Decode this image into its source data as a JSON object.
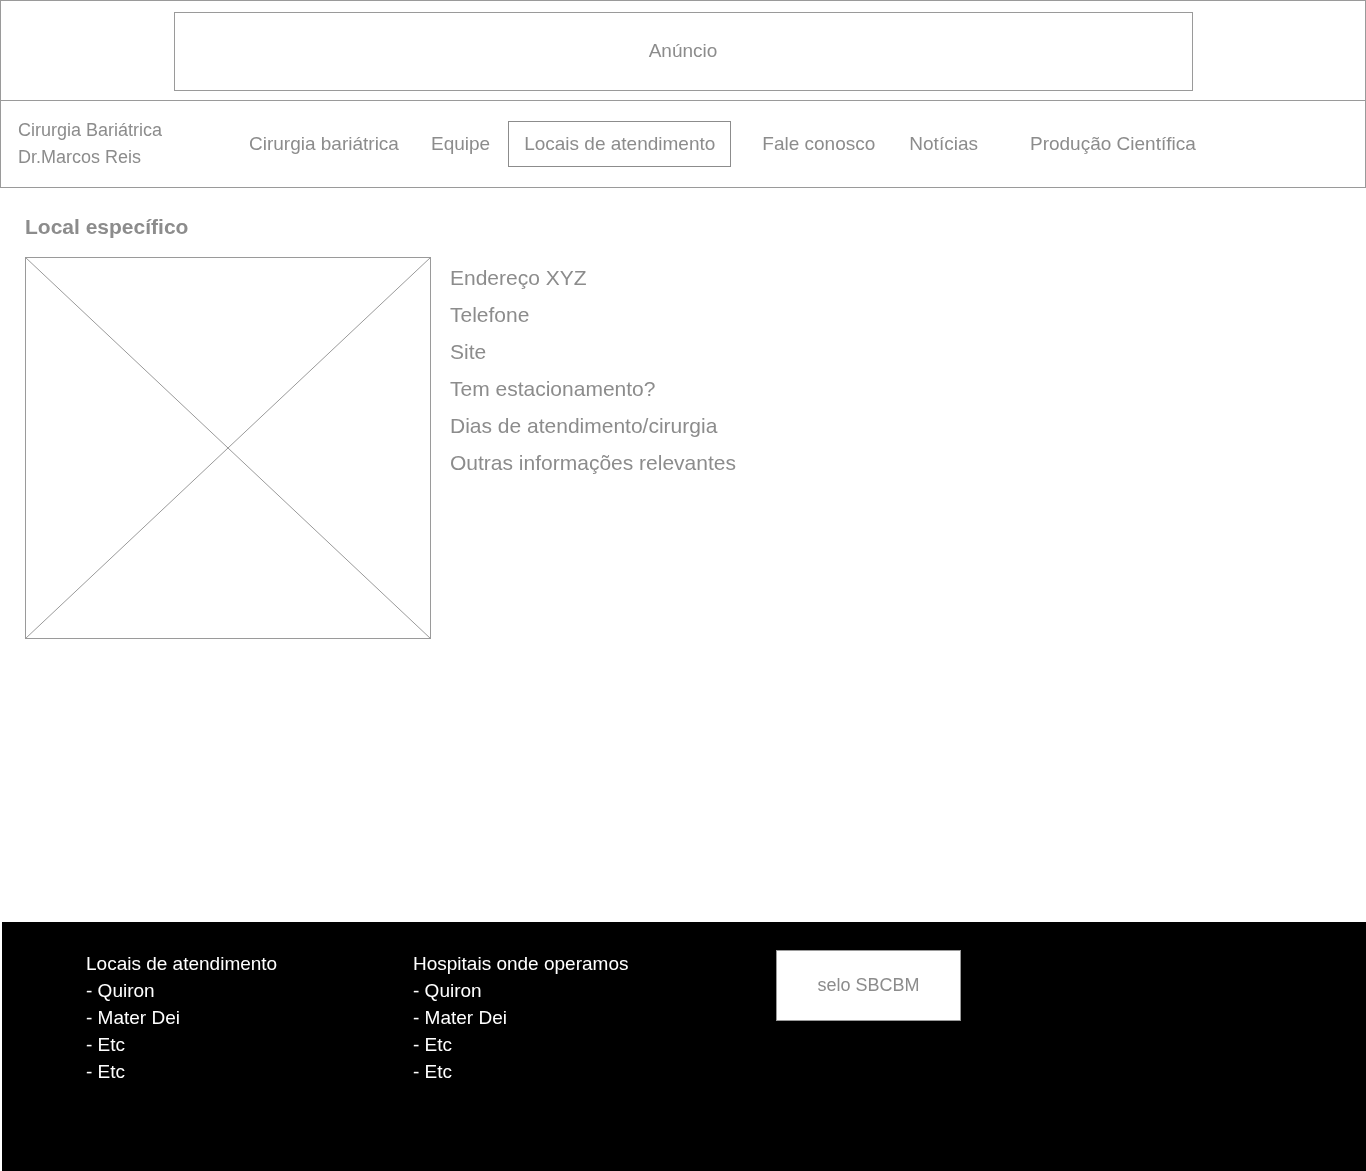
{
  "ad": {
    "label": "Anúncio"
  },
  "header": {
    "brand": [
      "Cirurgia Bariátrica",
      "Dr.Marcos Reis"
    ],
    "nav": [
      {
        "label": "Cirurgia bariátrica",
        "selected": false
      },
      {
        "label": "Equipe",
        "selected": false
      },
      {
        "label": "Locais de atendimento",
        "selected": true
      },
      {
        "label": "Fale conosco",
        "selected": false
      },
      {
        "label": "Notícias",
        "selected": false
      },
      {
        "label": "Produção Científica",
        "selected": false
      }
    ]
  },
  "content": {
    "title": "Local específico",
    "details": [
      "Endereço XYZ",
      "Telefone",
      "Site",
      "Tem estacionamento?",
      "Dias de atendimento/cirurgia",
      "Outras informações relevantes"
    ]
  },
  "footer": {
    "columns": [
      {
        "title": "Locais de atendimento",
        "items": [
          "- Quiron",
          "- Mater Dei",
          "- Etc",
          "- Etc"
        ]
      },
      {
        "title": "Hospitais onde operamos",
        "items": [
          "- Quiron",
          "- Mater Dei",
          "- Etc",
          "- Etc"
        ]
      }
    ],
    "seal": "selo SBCBM"
  }
}
